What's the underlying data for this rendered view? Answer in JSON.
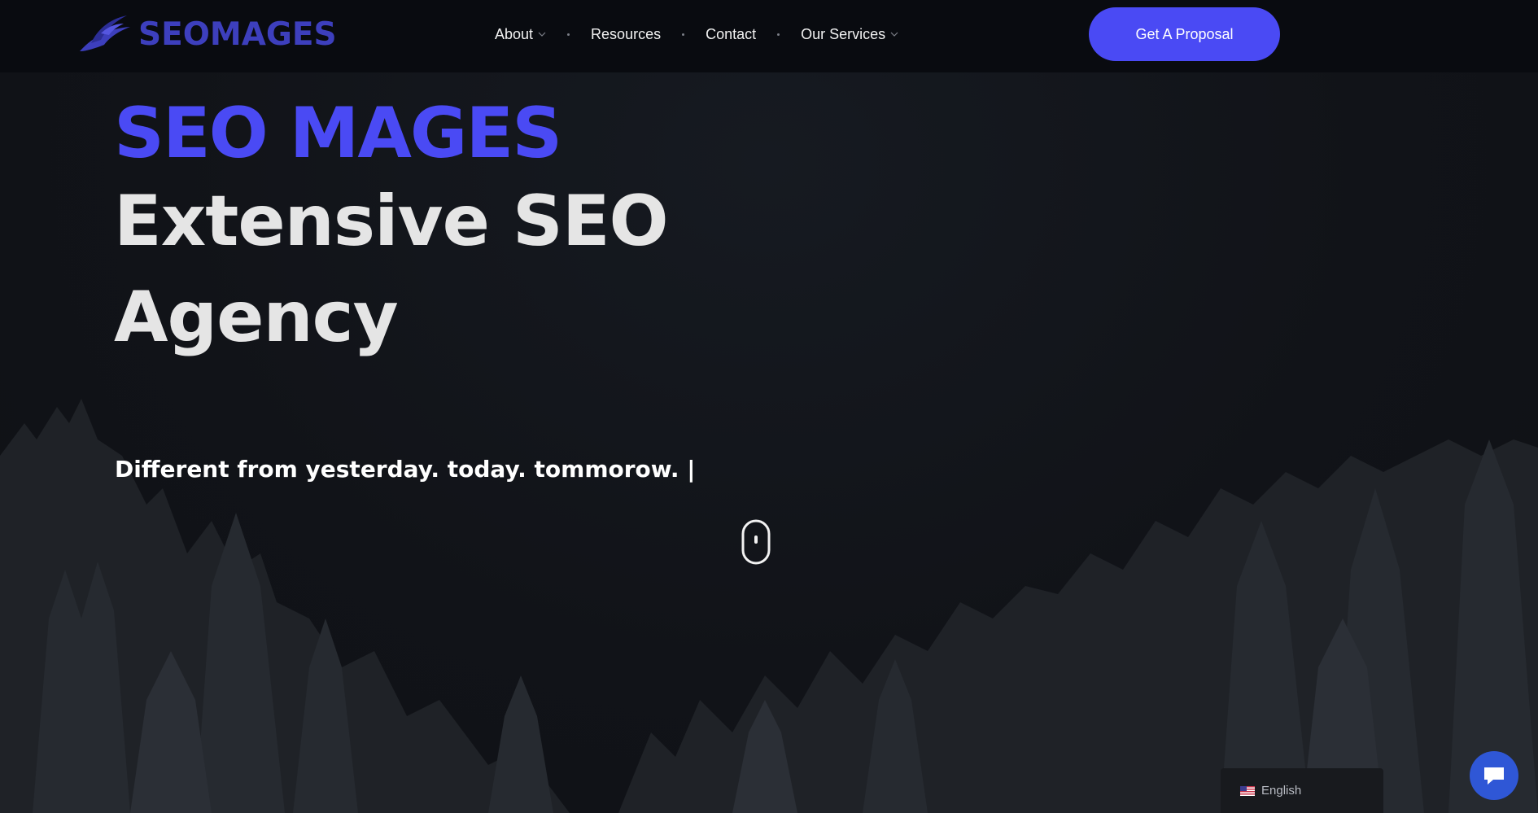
{
  "header": {
    "logo_text": "SEOMAGES",
    "nav": [
      {
        "label": "About",
        "has_dropdown": true
      },
      {
        "label": "Resources",
        "has_dropdown": false
      },
      {
        "label": "Contact",
        "has_dropdown": false
      },
      {
        "label": "Our Services",
        "has_dropdown": true
      }
    ],
    "cta_label": "Get A Proposal"
  },
  "hero": {
    "brand_title": "SEO MAGES",
    "headline": "Extensive SEO Agency",
    "tagline": "Different from yesterday. today. tommorow. |"
  },
  "footer_widgets": {
    "language_label": "English",
    "language_flag_icon": "us-flag-icon",
    "chat_icon": "chat-bubble-icon"
  },
  "colors": {
    "accent": "#4a4af4",
    "logo": "#3d3fbd",
    "header_bg": "#090b10",
    "page_bg": "#121419",
    "chat_button": "#2f57d6"
  }
}
